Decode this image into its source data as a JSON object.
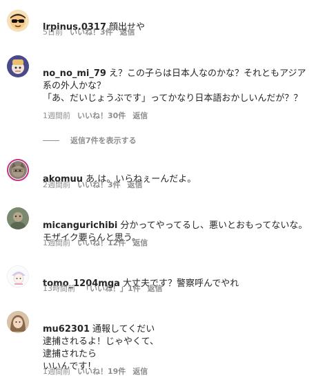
{
  "comments": [
    {
      "username": "lrpinus.0317",
      "text": "顔出せや",
      "time": "5日前",
      "likes": "いいね！3件",
      "reply": "返信"
    },
    {
      "username": "no_no_mi_79",
      "text": "え？この子らは日本人なのかな？それともアジア系の外人かな？\n「あ、だいじょうぶです」ってかなり日本語おかしいんだが？？",
      "time": "1週間前",
      "likes": "いいね！30件",
      "reply": "返信",
      "view_replies": "返信7件を表示する"
    },
    {
      "username": "akomuu",
      "text": "あ.は。いらねぇーんだよ。",
      "time": "2週間前",
      "likes": "いいね！3件",
      "reply": "返信"
    },
    {
      "username": "micangurichibi",
      "text": "分かってやってるし、悪いとおもってないな。モザイク要らんと思う。",
      "time": "1週間前",
      "likes": "いいね！12件",
      "reply": "返信"
    },
    {
      "username": "tomo_1204mga",
      "text": "大丈夫です？警察呼んでやれ",
      "time": "13時間前",
      "likes": "「いいね！」1件",
      "reply": "返信"
    },
    {
      "username": "mu62301",
      "text": "通報してくだい\n逮捕されるよ！じゃやくて、\n逮捕されたら\nいいんです！",
      "time": "1週間前",
      "likes": "いいね！19件",
      "reply": "返信"
    }
  ]
}
